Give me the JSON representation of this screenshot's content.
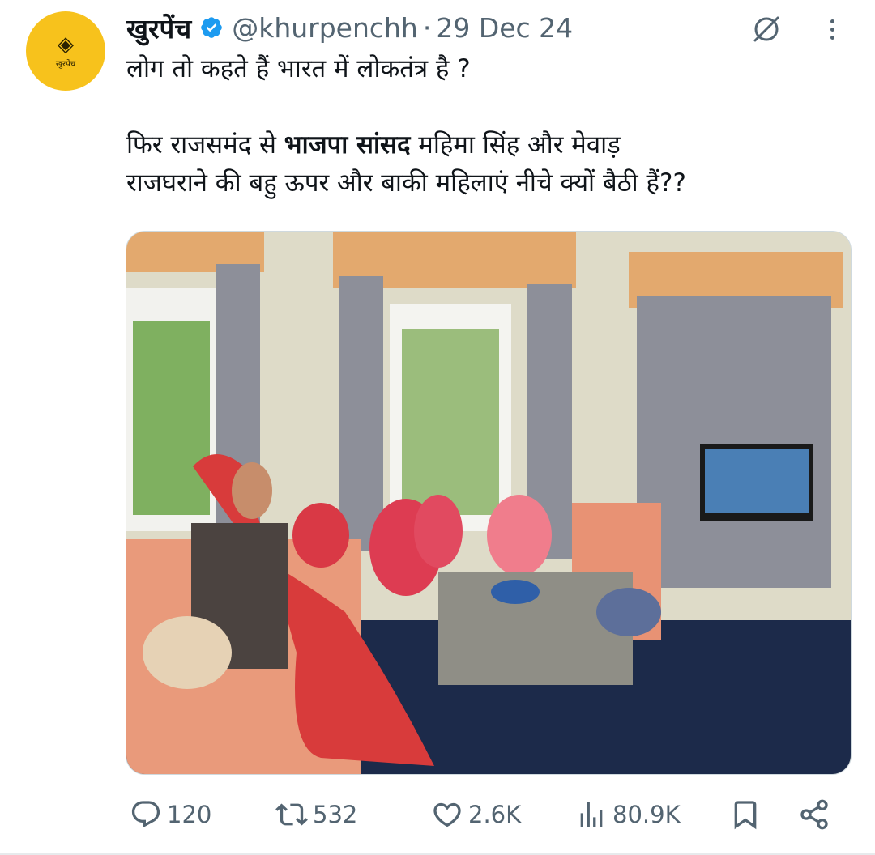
{
  "author": {
    "name": "खुरपेंच",
    "handle": "@khurpenchh",
    "separator": "·",
    "date": "29 Dec 24",
    "avatar_text": "खुरपेंच",
    "verified": true,
    "brand_color": "#f7c21c",
    "verified_color": "#1d9bf0"
  },
  "tweet": {
    "line1": "लोग तो कहते हैं भारत में लोकतंत्र है ?",
    "line2_pre": "फिर राजसमंद से ",
    "line2_bold": "भाजपा सांसद",
    "line2_post": " महिमा सिंह और मेवाड़",
    "line3": "राजघराने की बहु ऊपर और बाकी महिलाएं नीचे क्यों बैठी हैं??"
  },
  "icons": {
    "grok": "grok-icon",
    "more": "more-icon",
    "reply": "reply-icon",
    "retweet": "retweet-icon",
    "like": "like-icon",
    "views": "views-icon",
    "bookmark": "bookmark-icon",
    "share": "share-icon"
  },
  "actions": {
    "replies": "120",
    "retweets": "532",
    "likes": "2.6K",
    "views": "80.9K"
  },
  "colors": {
    "text": "#0f1419",
    "muted": "#536471"
  }
}
